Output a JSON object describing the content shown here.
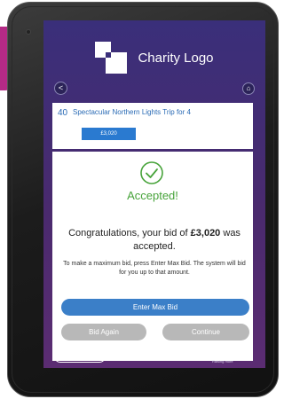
{
  "header": {
    "logo_text": "Charity Logo",
    "back_label": "<",
    "home_label": "⌂"
  },
  "lot": {
    "number": "40",
    "title": "Spectacular Northern Lights Trip for 4",
    "price": "£3,020"
  },
  "confirmation": {
    "status": "Accepted!",
    "message_before": "Congratulations, your bid of ",
    "bid_amount": "£3,020",
    "message_after": " was accepted.",
    "info": "To make a maximum bid, press Enter Max Bid. The system will bid for you up to that amount."
  },
  "buttons": {
    "enter_max_bid": "Enter Max Bid",
    "bid_again": "Bid Again",
    "continue": "Continue",
    "my_bids": "My Bids"
  },
  "footer": {
    "brand_name": "givergy",
    "brand_tagline": "Raising more"
  },
  "colors": {
    "accent_blue": "#3b7fc8",
    "success_green": "#47a33a",
    "screen_purple": "#3a2f7a",
    "disabled_grey": "#b8b8b8",
    "magenta": "#b52a86"
  }
}
